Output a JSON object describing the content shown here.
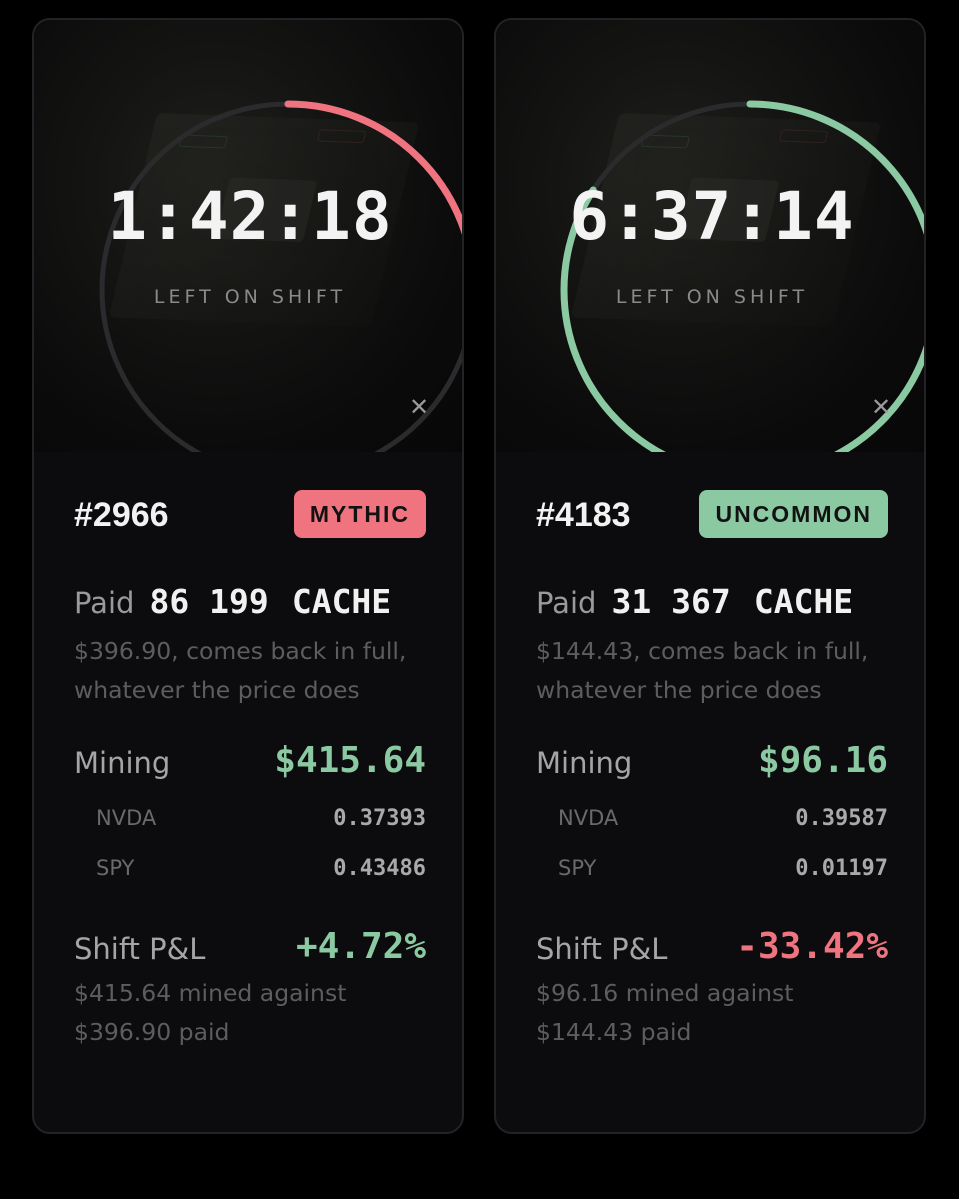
{
  "colors": {
    "mythic": "#ef7480",
    "uncommon": "#8bc9a2",
    "positive": "#8bc9a2",
    "negative": "#ef7480",
    "track": "#2b2b2e"
  },
  "cards": [
    {
      "timer": "1:42:18",
      "timer_label": "LEFT ON SHIFT",
      "progress": 0.28,
      "ring_color": "#ef7480",
      "close_icon": "close-icon",
      "id": "#2966",
      "rarity": "MYTHIC",
      "rarity_color": "#ef7480",
      "paid_label": "Paid",
      "paid_amount": "86 199",
      "paid_unit": "CACHE",
      "paid_note": "$396.90, comes back in full, whatever the price does",
      "mining_label": "Mining",
      "mining_value": "$415.64",
      "assets": [
        {
          "symbol": "NVDA",
          "value": "0.37393"
        },
        {
          "symbol": "SPY",
          "value": "0.43486"
        }
      ],
      "pnl_label": "Shift P&L",
      "pnl_value": "+4.72%",
      "pnl_color": "#8bc9a2",
      "pnl_note": "$415.64 mined against $396.90 paid"
    },
    {
      "timer": "6:37:14",
      "timer_label": "LEFT ON SHIFT",
      "progress": 0.84,
      "ring_color": "#8bc9a2",
      "close_icon": "close-icon",
      "id": "#4183",
      "rarity": "UNCOMMON",
      "rarity_color": "#8bc9a2",
      "paid_label": "Paid",
      "paid_amount": "31 367",
      "paid_unit": "CACHE",
      "paid_note": "$144.43, comes back in full, whatever the price does",
      "mining_label": "Mining",
      "mining_value": "$96.16",
      "assets": [
        {
          "symbol": "NVDA",
          "value": "0.39587"
        },
        {
          "symbol": "SPY",
          "value": "0.01197"
        }
      ],
      "pnl_label": "Shift P&L",
      "pnl_value": "-33.42%",
      "pnl_color": "#ef7480",
      "pnl_note": "$96.16 mined against $144.43 paid"
    }
  ]
}
